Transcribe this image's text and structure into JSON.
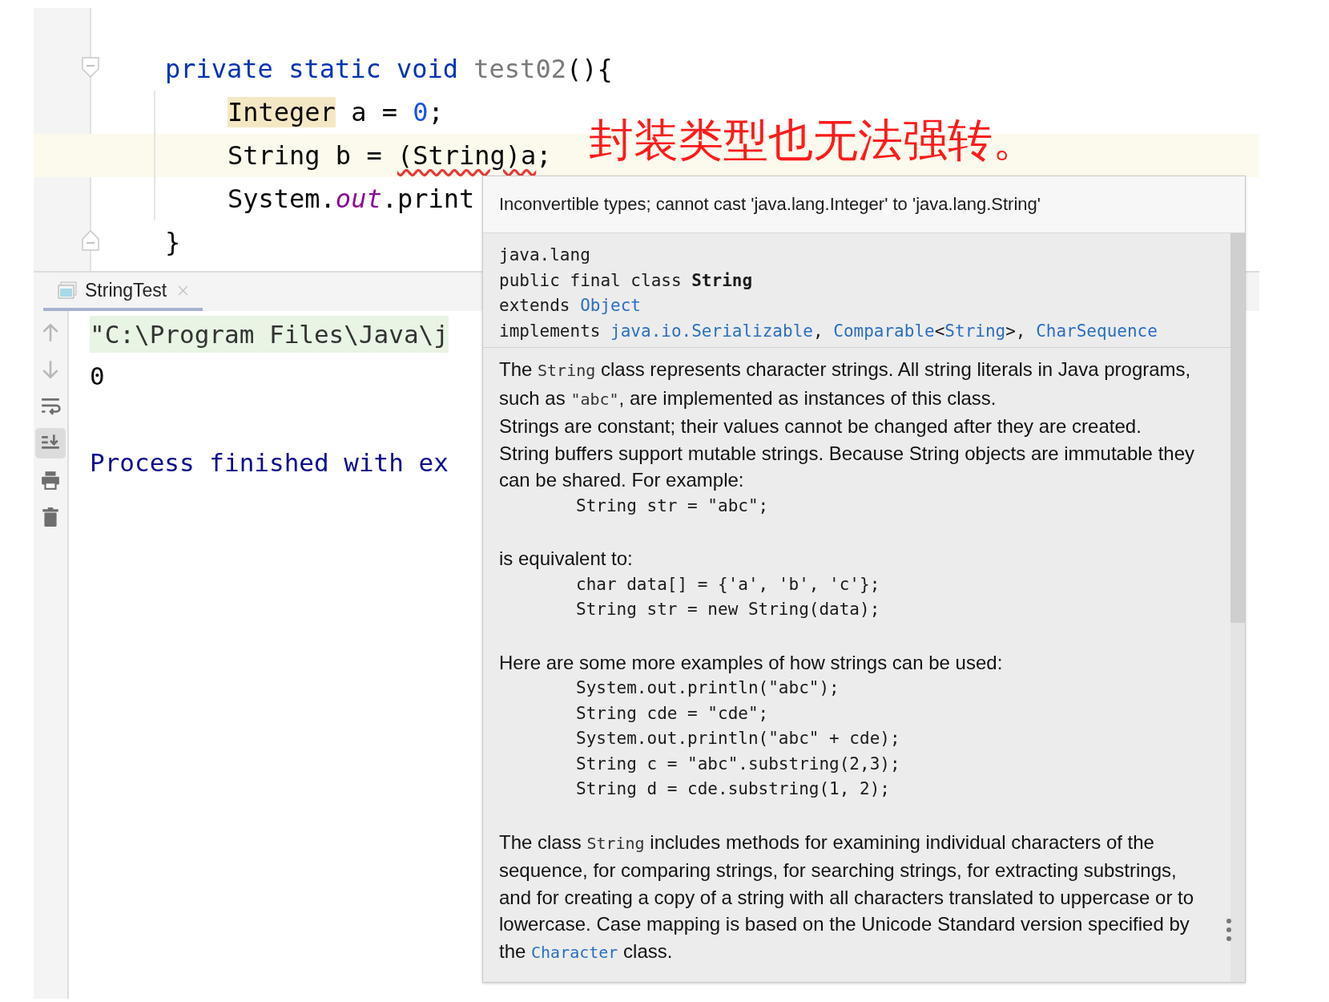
{
  "editor": {
    "lines": [
      {
        "fold_start": true,
        "tokens": [
          {
            "kind": "keyword",
            "text": "private static void "
          },
          {
            "kind": "method",
            "text": "test02"
          },
          {
            "kind": "plain",
            "text": "(){"
          }
        ],
        "children": [
          {
            "current": false,
            "tokens": [
              {
                "kind": "usage",
                "text": "Integer"
              },
              {
                "kind": "plain",
                "text": " a = "
              },
              {
                "kind": "number",
                "text": "0"
              },
              {
                "kind": "plain",
                "text": ";"
              }
            ]
          },
          {
            "current": true,
            "tokens": [
              {
                "kind": "plain",
                "text": "String b = "
              },
              {
                "kind": "error",
                "text": "(String)a"
              },
              {
                "kind": "plain",
                "text": ";"
              }
            ]
          },
          {
            "current": false,
            "tokens": [
              {
                "kind": "plain",
                "text": "System."
              },
              {
                "kind": "field",
                "text": "out"
              },
              {
                "kind": "plain",
                "text": ".print"
              }
            ]
          }
        ]
      },
      {
        "fold_end": true,
        "tokens": [
          {
            "kind": "plain",
            "text": "}"
          }
        ]
      }
    ]
  },
  "annotation": {
    "text": "封装类型也无法强转。"
  },
  "console": {
    "tabs": [
      {
        "label": "StringTest",
        "selected": true
      }
    ],
    "tools": [
      {
        "kind": "up",
        "selected": false
      },
      {
        "kind": "down",
        "selected": false
      },
      {
        "kind": "wrap",
        "selected": false
      },
      {
        "kind": "scroll-end",
        "selected": true
      },
      {
        "kind": "print",
        "selected": false
      },
      {
        "kind": "trash",
        "selected": false
      }
    ],
    "output": [
      {
        "kind": "command",
        "text": "\"C:\\Program Files\\Java\\j"
      },
      {
        "kind": "stdout",
        "text": "0"
      },
      {
        "kind": "system",
        "text": "Process finished with ex"
      }
    ]
  },
  "popup": {
    "error": "Inconvertible types; cannot cast 'java.lang.Integer' to 'java.lang.String'",
    "signature": [
      [
        {
          "kind": "plain",
          "text": "java.lang"
        }
      ],
      [
        {
          "kind": "plain",
          "text": "public final class "
        },
        {
          "kind": "bold",
          "text": "String"
        }
      ],
      [
        {
          "kind": "plain",
          "text": "extends "
        },
        {
          "kind": "link",
          "text": "Object"
        }
      ],
      [
        {
          "kind": "plain",
          "text": "implements "
        },
        {
          "kind": "link",
          "text": "java.io.Serializable"
        },
        {
          "kind": "plain",
          "text": ", "
        },
        {
          "kind": "link",
          "text": "Comparable"
        },
        {
          "kind": "plain",
          "text": "<"
        },
        {
          "kind": "link",
          "text": "String"
        },
        {
          "kind": "plain",
          "text": ">, "
        },
        {
          "kind": "link",
          "text": "CharSequence"
        }
      ]
    ],
    "body": [
      {
        "kind": "para",
        "parts": [
          {
            "kind": "text",
            "text": "The "
          },
          {
            "kind": "code",
            "text": "String"
          },
          {
            "kind": "text",
            "text": " class represents character strings. All string literals in Java programs, such as "
          },
          {
            "kind": "code",
            "text": "\"abc\""
          },
          {
            "kind": "text",
            "text": ", are implemented as instances of this class."
          }
        ]
      },
      {
        "kind": "para",
        "parts": [
          {
            "kind": "text",
            "text": "Strings are constant; their values cannot be changed after they are created."
          }
        ]
      },
      {
        "kind": "para",
        "parts": [
          {
            "kind": "text",
            "text": "String buffers support mutable strings. Because String objects are immutable they can be shared. For example:"
          }
        ]
      },
      {
        "kind": "code",
        "lines": [
          "String str = \"abc\";"
        ]
      },
      {
        "kind": "para",
        "parts": [
          {
            "kind": "text",
            "text": "is equivalent to:"
          }
        ]
      },
      {
        "kind": "code",
        "lines": [
          "char data[] = {'a', 'b', 'c'};",
          "String str = new String(data);"
        ]
      },
      {
        "kind": "para",
        "parts": [
          {
            "kind": "text",
            "text": "Here are some more examples of how strings can be used:"
          }
        ]
      },
      {
        "kind": "code",
        "lines": [
          "System.out.println(\"abc\");",
          "String cde = \"cde\";",
          "System.out.println(\"abc\" + cde);",
          "String c = \"abc\".substring(2,3);",
          "String d = cde.substring(1, 2);"
        ]
      },
      {
        "kind": "para",
        "parts": [
          {
            "kind": "text",
            "text": "The class "
          },
          {
            "kind": "code",
            "text": "String"
          },
          {
            "kind": "text",
            "text": " includes methods for examining individual characters of the sequence, for comparing strings, for searching strings, for extracting substrings, and for creating a copy of a string with all characters translated to uppercase or to lowercase. Case mapping is based on the Unicode Standard version specified by the "
          },
          {
            "kind": "link",
            "text": "Character"
          },
          {
            "kind": "text",
            "text": " class."
          }
        ]
      }
    ]
  }
}
